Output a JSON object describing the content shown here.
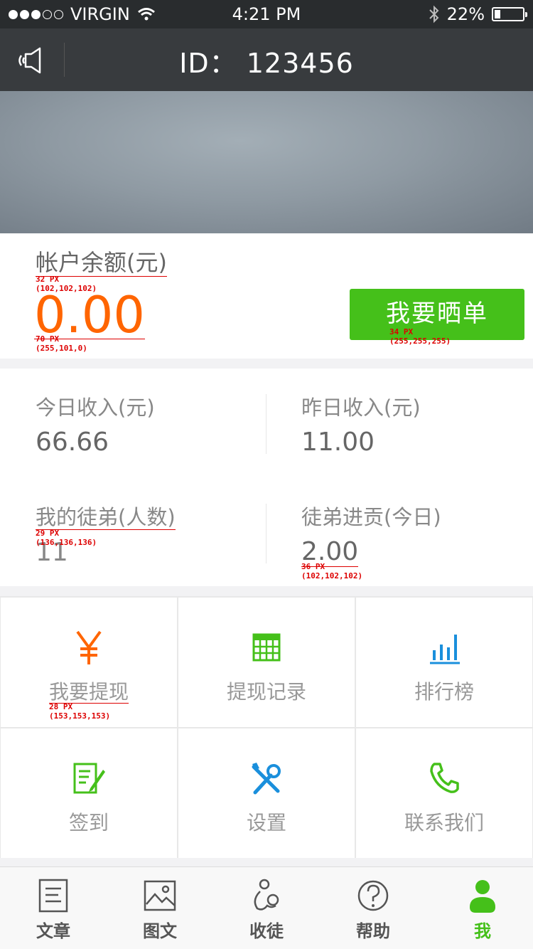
{
  "status": {
    "carrier": "VIRGIN",
    "time": "4:21 PM",
    "battery": "22%"
  },
  "nav": {
    "title": "ID：  123456"
  },
  "balance": {
    "label": "帐户余额(元)",
    "label_note": "32 PX\n(102,102,102)",
    "amount": "0.00",
    "amount_note": "70 PX\n(255,101,0)",
    "button": "我要晒单",
    "button_note": "34 PX\n(255,255,255)"
  },
  "stats": {
    "today": {
      "label": "今日收入(元)",
      "value": "66.66"
    },
    "yesterday": {
      "label": "昨日收入(元)",
      "value": "11.00"
    },
    "apprentices": {
      "label": "我的徒弟(人数)",
      "value": "11",
      "note": "29 PX\n(136,136,136)"
    },
    "contribution": {
      "label": "徒弟进贡(今日)",
      "value": "2.00",
      "note": "36 PX\n(102,102,102)"
    }
  },
  "menu": {
    "note": "28 PX\n(153,153,153)",
    "items": [
      {
        "label": "我要提现",
        "icon": "yen-icon",
        "color": "#ff6500"
      },
      {
        "label": "提现记录",
        "icon": "calculator-icon",
        "color": "#45c01a"
      },
      {
        "label": "排行榜",
        "icon": "bar-chart-icon",
        "color": "#1a8fdc"
      },
      {
        "label": "签到",
        "icon": "sign-in-icon",
        "color": "#45c01a"
      },
      {
        "label": "设置",
        "icon": "tools-icon",
        "color": "#1a8fdc"
      },
      {
        "label": "联系我们",
        "icon": "phone-icon",
        "color": "#45c01a"
      }
    ]
  },
  "tabs": [
    {
      "label": "文章",
      "icon": "document-icon"
    },
    {
      "label": "图文",
      "icon": "image-icon"
    },
    {
      "label": "收徒",
      "icon": "recruit-icon"
    },
    {
      "label": "帮助",
      "icon": "help-icon"
    },
    {
      "label": "我",
      "icon": "user-icon",
      "active": true
    }
  ],
  "colors": {
    "accent_green": "#45c01a",
    "amount_orange": "#ff6500",
    "nav_bg": "#383b3e"
  }
}
